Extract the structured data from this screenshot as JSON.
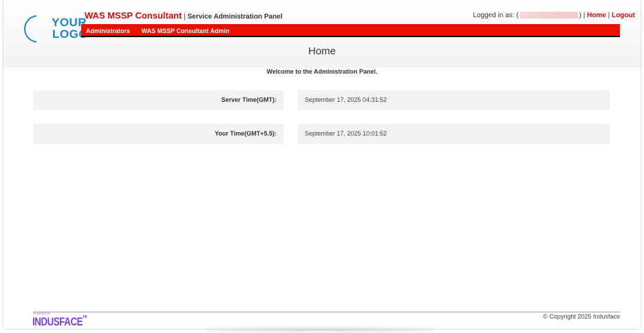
{
  "logo": {
    "line1": "YOUR",
    "line2": "LOGO"
  },
  "app": {
    "title": "WAS MSSP Consultant",
    "separator": " | ",
    "subtitle": "Service Administration Panel"
  },
  "user": {
    "logged_in_label": "Logged in as:",
    "account_prefix": "(",
    "account_suffix": ")",
    "separator": " | ",
    "home_link": "Home",
    "logout_link": "Logout"
  },
  "nav": {
    "items": [
      {
        "label": "Administrators"
      },
      {
        "label": "WAS MSSP Consultant Admin"
      }
    ]
  },
  "main": {
    "title": "Home",
    "welcome": "Welcome to the Administration Panel.",
    "server_time_label": "Server Time(GMT):",
    "server_time_value": "September 17, 2025 04:31:52",
    "your_time_label": "Your Time(GMT+5.5):",
    "your_time_value": "September 17, 2025 10:01:52"
  },
  "footer": {
    "copyright": "© Copyright 2025 Indusface",
    "powered_by": "POWERED BY",
    "brand": "INDUSFACE",
    "brand_mark": "TM"
  },
  "colors": {
    "accent_red": "#ee0f00",
    "title_red": "#d60b0b",
    "logo_blue": "#1b86c9",
    "brand_purple": "#7b3fd9"
  }
}
